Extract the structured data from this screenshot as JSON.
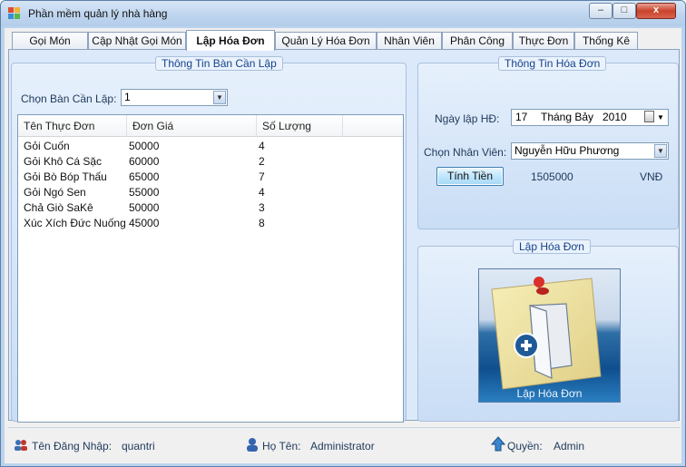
{
  "window": {
    "title": "Phần mềm quản lý nhà hàng",
    "controls": {
      "minimize": "–",
      "maximize": "□",
      "close": "x"
    }
  },
  "tabs": [
    {
      "label": "Gọi Món",
      "active": false
    },
    {
      "label": "Cập Nhật Gọi Món",
      "active": false
    },
    {
      "label": "Lập Hóa Đơn",
      "active": true
    },
    {
      "label": "Quản Lý Hóa Đơn",
      "active": false
    },
    {
      "label": "Nhân Viên",
      "active": false
    },
    {
      "label": "Phân Công",
      "active": false
    },
    {
      "label": "Thực Đơn",
      "active": false
    },
    {
      "label": "Thống Kê",
      "active": false
    }
  ],
  "table_panel": {
    "title": "Thông Tin Bàn Cần Lập",
    "select_label": "Chọn Bàn Cần Lập:",
    "select_value": "1",
    "columns": [
      "Tên Thực Đơn",
      "Đơn Giá",
      "Số Lượng"
    ],
    "rows": [
      {
        "name": "Gỏi Cuốn",
        "price": "50000",
        "qty": "4"
      },
      {
        "name": "Gỏi Khô Cá Sặc",
        "price": "60000",
        "qty": "2"
      },
      {
        "name": "Gỏi Bò Bóp Thấu",
        "price": "65000",
        "qty": "7"
      },
      {
        "name": "Gỏi Ngó Sen",
        "price": "55000",
        "qty": "4"
      },
      {
        "name": "Chả Giò SaKê",
        "price": "50000",
        "qty": "3"
      },
      {
        "name": "Xúc Xích Đức Nuống",
        "price": "45000",
        "qty": "8"
      }
    ]
  },
  "invoice_panel": {
    "title": "Thông Tin Hóa Đơn",
    "date_label": "Ngày lập HĐ:",
    "date_day": "17",
    "date_month": "Tháng Bảy",
    "date_year": "2010",
    "staff_label": "Chọn Nhân Viên:",
    "staff_value": "Nguyễn Hữu Phương",
    "calc_button": "Tính Tiền",
    "total": "1505000",
    "currency": "VNĐ"
  },
  "create_panel": {
    "title": "Lập Hóa Đơn",
    "button_label": "Lập Hóa Đơn"
  },
  "status": {
    "login_label": "Tên Đăng Nhập:",
    "login_value": "quantri",
    "name_label": "Họ Tên:",
    "name_value": "Administrator",
    "role_label": "Quyền:",
    "role_value": "Admin"
  },
  "colors": {
    "title_text": "#15428b",
    "panel_bg": "#dbe9fa",
    "button_face": "#bee6fd"
  }
}
